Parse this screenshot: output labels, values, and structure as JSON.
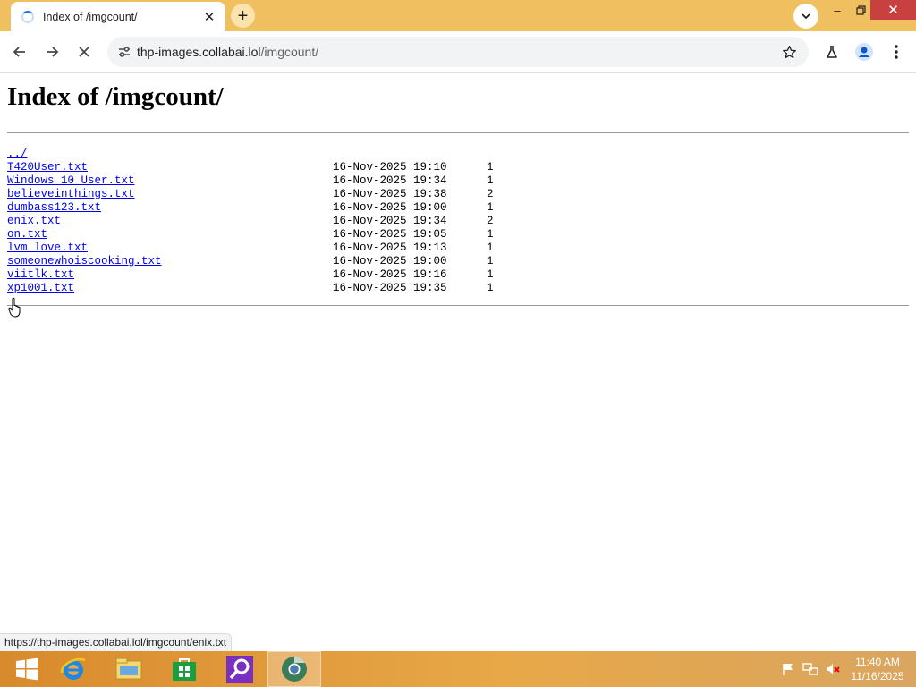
{
  "browser": {
    "tab": {
      "title": "Index of /imgcount/"
    },
    "address": {
      "host": "thp-images.collabai.lol",
      "path": "/imgcount/"
    }
  },
  "page": {
    "heading": "Index of /imgcount/",
    "parent_link": "../",
    "entries": [
      {
        "name": "T420User.txt",
        "date": "16-Nov-2025 19:10",
        "size": "1"
      },
      {
        "name": "Windows 10 User.txt",
        "date": "16-Nov-2025 19:34",
        "size": "1"
      },
      {
        "name": "believeinthings.txt",
        "date": "16-Nov-2025 19:38",
        "size": "2"
      },
      {
        "name": "dumbass123.txt",
        "date": "16-Nov-2025 19:00",
        "size": "1"
      },
      {
        "name": "enix.txt",
        "date": "16-Nov-2025 19:34",
        "size": "2"
      },
      {
        "name": "on.txt",
        "date": "16-Nov-2025 19:05",
        "size": "1"
      },
      {
        "name": "lvm_love.txt",
        "date": "16-Nov-2025 19:13",
        "size": "1"
      },
      {
        "name": "someonewhoiscooking.txt",
        "date": "16-Nov-2025 19:00",
        "size": "1"
      },
      {
        "name": "viitlk.txt",
        "date": "16-Nov-2025 19:16",
        "size": "1"
      },
      {
        "name": "xp1001.txt",
        "date": "16-Nov-2025 19:35",
        "size": "1"
      }
    ]
  },
  "status_bar": {
    "hover_url": "https://thp-images.collabai.lol/imgcount/enix.txt"
  },
  "taskbar": {
    "items": [
      "start-icon",
      "internet-explorer-icon",
      "file-explorer-icon",
      "store-icon",
      "search-app-icon",
      "chrome-icon"
    ],
    "active_item": "chrome-icon",
    "clock": {
      "time": "11:40 AM",
      "date": "11/16/2025"
    }
  },
  "colors": {
    "titlebar": "#f0c060",
    "link": "#0000ee",
    "taskbar": "#e8a848",
    "close": "#c94040"
  }
}
